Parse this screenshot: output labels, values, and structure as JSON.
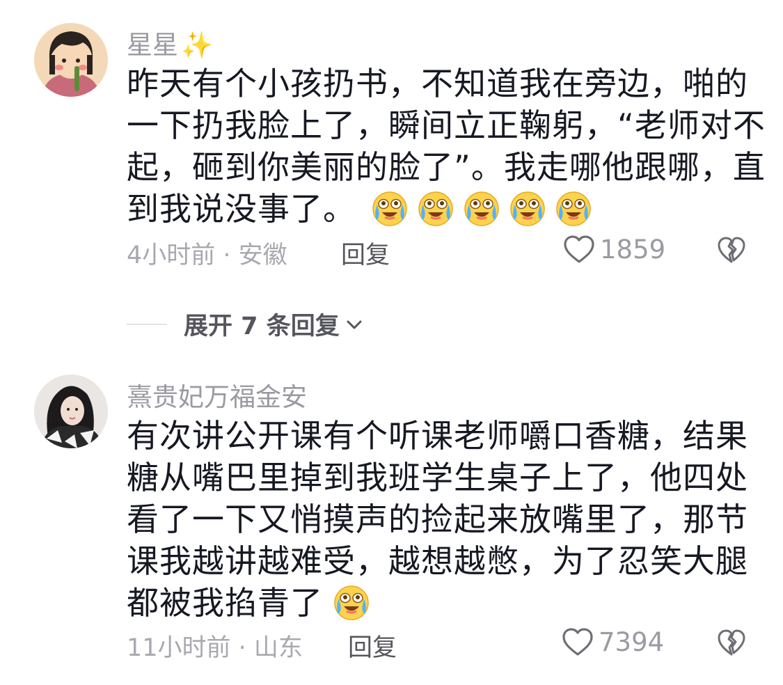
{
  "comments": [
    {
      "username": "星星",
      "username_suffix": "✨",
      "avatar": "girl-cartoon-avatar",
      "lines": [
        "昨天有个小孩扔书，不知道我在旁边，啪的",
        "一下扔我脸上了，瞬间立正鞠躬，“老师对不",
        "起，砸到你美丽的脸了”。我走哪他跟哪，直",
        "到我说没事了。"
      ],
      "emoji": "laugh-cry-emoji",
      "emoji_count": 5,
      "time_location": "4小时前 · 安徽",
      "reply_label": "回复",
      "likes": "1859"
    },
    {
      "username": "熹贵妃万福金安",
      "username_suffix": "",
      "avatar": "woman-photo-avatar",
      "lines": [
        "有次讲公开课有个听课老师嚼口香糖，结果",
        "糖从嘴巴里掉到我班学生桌子上了，他四处",
        "看了一下又悄摸声的捡起来放嘴里了，那节",
        "课我越讲越难受，越想越憋，为了忍笑大腿",
        "都被我掐青了"
      ],
      "emoji": "laugh-cry-emoji",
      "emoji_count": 1,
      "time_location": "11小时前 · 山东",
      "reply_label": "回复",
      "likes": "7394"
    }
  ],
  "expand_replies": {
    "label": "展开 7 条回复",
    "icon": "chevron-down-icon"
  },
  "colors": {
    "text": "#161823",
    "muted": "#9a9aa2",
    "reply": "#55555d",
    "emoji_yellow": "#fcd34d"
  }
}
